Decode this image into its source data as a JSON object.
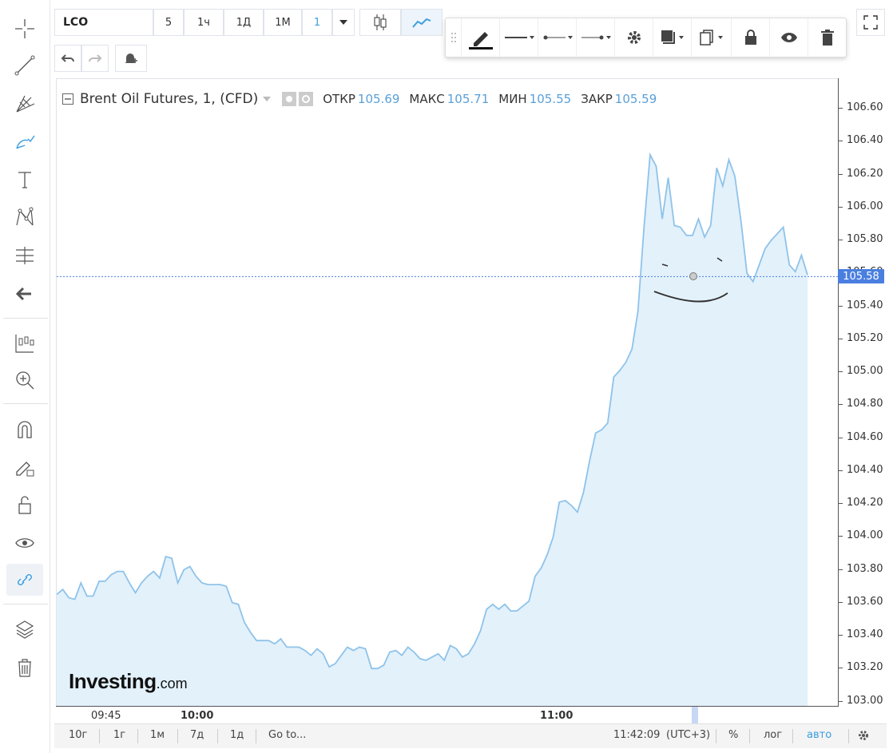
{
  "symbol": "LCO",
  "intervals": [
    "5",
    "1ч",
    "1Д",
    "1М",
    "1"
  ],
  "legend": {
    "title": "Brent Oil Futures, 1, (CFD)",
    "open_label": "ОТКР",
    "open": "105.69",
    "high_label": "МАКС",
    "high": "105.71",
    "low_label": "МИН",
    "low": "105.55",
    "close_label": "ЗАКР",
    "close": "105.59"
  },
  "current_price": "105.58",
  "price_axis": [
    "106.60",
    "106.40",
    "106.20",
    "106.00",
    "105.80",
    "105.60",
    "105.40",
    "105.20",
    "105.00",
    "104.80",
    "104.60",
    "104.40",
    "104.20",
    "104.00",
    "103.80",
    "103.60",
    "103.40",
    "103.20",
    "103.00"
  ],
  "time_axis": {
    "t0945": "09:45",
    "t1000": "10:00",
    "t1100": "11:00"
  },
  "bottom": {
    "r10y": "10г",
    "r1y": "1г",
    "r1m": "1м",
    "r7d": "7д",
    "r1d": "1д",
    "goto": "Go to...",
    "clock": "11:42:09",
    "tz": "(UTC+3)",
    "pct": "%",
    "log": "лог",
    "auto": "авто"
  },
  "logo": {
    "main": "Investing",
    "suffix": ".com"
  },
  "colors": {
    "line": "#8ec3ea",
    "fill": "#e3f1fb",
    "accent": "#4a7fe0",
    "value": "#5aa0d8"
  },
  "chart_data": {
    "type": "area",
    "ylim": [
      103.0,
      106.6
    ],
    "y": [
      103.65,
      103.68,
      103.63,
      103.62,
      103.72,
      103.64,
      103.64,
      103.73,
      103.73,
      103.77,
      103.79,
      103.79,
      103.72,
      103.66,
      103.72,
      103.76,
      103.79,
      103.75,
      103.88,
      103.87,
      103.72,
      103.8,
      103.82,
      103.76,
      103.72,
      103.71,
      103.71,
      103.71,
      103.7,
      103.6,
      103.59,
      103.48,
      103.42,
      103.37,
      103.37,
      103.37,
      103.35,
      103.38,
      103.33,
      103.33,
      103.33,
      103.31,
      103.28,
      103.32,
      103.29,
      103.21,
      103.23,
      103.28,
      103.33,
      103.31,
      103.33,
      103.32,
      103.2,
      103.2,
      103.22,
      103.3,
      103.31,
      103.28,
      103.33,
      103.3,
      103.26,
      103.25,
      103.27,
      103.29,
      103.25,
      103.34,
      103.32,
      103.27,
      103.29,
      103.35,
      103.43,
      103.56,
      103.59,
      103.56,
      103.59,
      103.55,
      103.55,
      103.58,
      103.61,
      103.76,
      103.81,
      103.89,
      104.0,
      104.21,
      104.22,
      104.19,
      104.15,
      104.27,
      104.46,
      104.63,
      104.65,
      104.69,
      104.97,
      105.01,
      105.06,
      105.14,
      105.37,
      105.88,
      106.32,
      106.25,
      105.93,
      106.18,
      105.89,
      105.88,
      105.83,
      105.83,
      105.93,
      105.82,
      105.89,
      106.24,
      106.13,
      106.29,
      106.19,
      105.92,
      105.6,
      105.55,
      105.65,
      105.75,
      105.8,
      105.84,
      105.88,
      105.65,
      105.61,
      105.71,
      105.59
    ]
  }
}
